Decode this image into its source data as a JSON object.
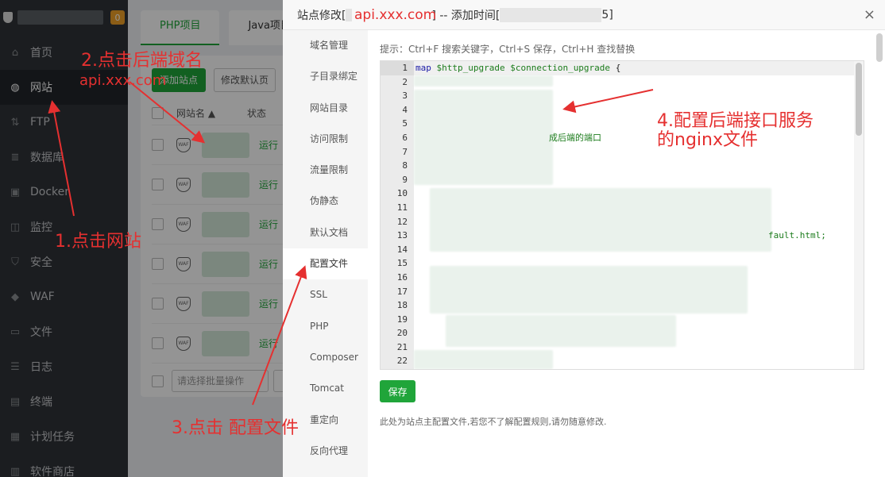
{
  "sidebar": {
    "badge": "0",
    "items": [
      {
        "label": "首页",
        "icon": "home-icon"
      },
      {
        "label": "网站",
        "icon": "globe-icon"
      },
      {
        "label": "FTP",
        "icon": "ftp-icon"
      },
      {
        "label": "数据库",
        "icon": "database-icon"
      },
      {
        "label": "Docker",
        "icon": "docker-icon"
      },
      {
        "label": "监控",
        "icon": "monitor-icon"
      },
      {
        "label": "安全",
        "icon": "shield-icon"
      },
      {
        "label": "WAF",
        "icon": "waf-icon"
      },
      {
        "label": "文件",
        "icon": "folder-icon"
      },
      {
        "label": "日志",
        "icon": "log-icon"
      },
      {
        "label": "终端",
        "icon": "terminal-icon"
      },
      {
        "label": "计划任务",
        "icon": "calendar-icon"
      },
      {
        "label": "软件商店",
        "icon": "store-icon"
      }
    ]
  },
  "main": {
    "tabs": [
      "PHP项目",
      "Java项目"
    ],
    "add_site": "添加站点",
    "edit_default": "修改默认页",
    "table": {
      "col_site": "网站名 ▲",
      "col_state": "状态"
    },
    "rows": [
      {
        "state": "运行"
      },
      {
        "state": "运行"
      },
      {
        "state": "运行"
      },
      {
        "state": "运行"
      },
      {
        "state": "运行"
      },
      {
        "state": "运行"
      }
    ],
    "batch_placeholder": "请选择批量操作"
  },
  "dialog": {
    "title_prefix": "站点修改[",
    "title_mid": "] -- 添加时间[",
    "title_end": "5]",
    "close": "×",
    "nav": [
      "域名管理",
      "子目录绑定",
      "网站目录",
      "访问限制",
      "流量限制",
      "伪静态",
      "默认文档",
      "配置文件",
      "SSL",
      "PHP",
      "Composer",
      "Tomcat",
      "重定向",
      "反向代理"
    ],
    "hint": "提示：Ctrl+F 搜索关键字，Ctrl+S 保存，Ctrl+H 查找替换",
    "line_numbers": [
      "1",
      "2",
      "3",
      "4",
      "5",
      "6",
      "7",
      "8",
      "9",
      "10",
      "11",
      "12",
      "13",
      "14",
      "15",
      "16",
      "17",
      "18",
      "19",
      "20",
      "21",
      "22"
    ],
    "code_line1": {
      "kw": "map",
      "v1": "$http_upgrade",
      "v2": "$connection_upgrade",
      "brace": "{"
    },
    "code_line6_tail": "成后端的端口",
    "code_line13_tail": "fault.html;",
    "save": "保存",
    "note": "此处为站点主配置文件,若您不了解配置规则,请勿随意修改."
  },
  "annotations": {
    "step1": "1.点击网站",
    "step2": "2.点击后端域名",
    "step2_domain": "api.xxx.com",
    "step3": "3.点击  配置文件",
    "step4_line1": "4.配置后端接口服务",
    "step4_line2": "的nginx文件",
    "title_domain": "api.xxx.com",
    "color": "#e53030"
  }
}
